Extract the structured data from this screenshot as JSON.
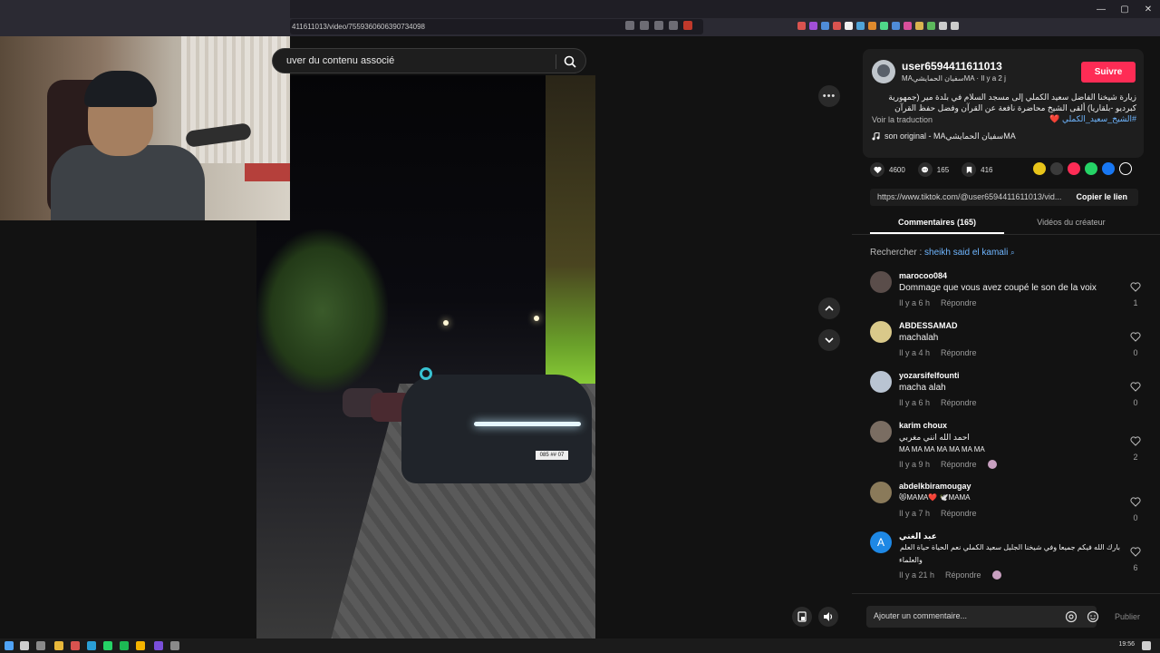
{
  "browser": {
    "url": "411611013/video/7559360606390734098",
    "window_controls": [
      "—",
      "▢",
      "✕"
    ]
  },
  "search": {
    "placeholder": "uver du contenu associé"
  },
  "video": {
    "plate": "085 ## 07"
  },
  "author": {
    "username": "user6594411611013",
    "display_sub": "MAسفيان الحمايشيMA · Il y a 2 j",
    "follow_label": "Suivre",
    "description": "زيارة شيخنا الفاضل سعيد الكملي إلى مسجد السلام في بلدة مير (جمهورية كبرديو -بلقاريا) ألقى الشيخ محاضرة نافعة عن القرآن وفضل حفظ القرآن",
    "hashtag": "#الشيخ_سعيد_الكملي",
    "heart": "❤️",
    "translate_label": "Voir la traduction",
    "sound": "son original - MAسفيان الحمايشيMA"
  },
  "stats": {
    "likes": "4600",
    "comments": "165",
    "saves": "416"
  },
  "share": {
    "link": "https://www.tiktok.com/@user6594411611013/vid...",
    "copy_label": "Copier le lien"
  },
  "tabs": {
    "comments": "Commentaires (165)",
    "creator": "Vidéos du créateur"
  },
  "comment_search": {
    "prefix": "Rechercher :",
    "keyword": "sheikh said el kamali"
  },
  "comments": [
    {
      "user": "marocoo084",
      "text": "Dommage que vous avez coupé le son de la voix",
      "time": "Il y a 6 h",
      "reply": "Répondre",
      "likes": "1"
    },
    {
      "user": "ABDESSAMAD",
      "text": "machalah",
      "time": "Il y a 4 h",
      "reply": "Répondre",
      "likes": "0"
    },
    {
      "user": "yozarsifelfounti",
      "text": "macha alah",
      "time": "Il y a 6 h",
      "reply": "Répondre",
      "likes": "0"
    },
    {
      "user": "karim choux",
      "text": "احمد الله انني مغربي",
      "text2": "MA MA MA MA MA MA MA",
      "time": "Il y a 9 h",
      "reply": "Répondre",
      "likes": "2"
    },
    {
      "user": "abdelkbiramougay",
      "text": "😻MAMA❤️ 🕊️MAMA",
      "time": "Il y a 7 h",
      "reply": "Répondre",
      "likes": "0"
    },
    {
      "user": "عبد الغني",
      "text": "بارك الله فيكم جميعا وفي شيخنا الجليل سعيد الكملي نعم الحياة حياة العلم",
      "text2": "والعلماء",
      "time": "Il y a 21 h",
      "reply": "Répondre",
      "likes": "6"
    }
  ],
  "composer": {
    "placeholder": "Ajouter un commentaire...",
    "post_label": "Publier"
  },
  "taskbar": {
    "clock": "19:56"
  },
  "colors": {
    "accent": "#fe2c55",
    "link": "#6fb6ff",
    "background": "#121212"
  }
}
